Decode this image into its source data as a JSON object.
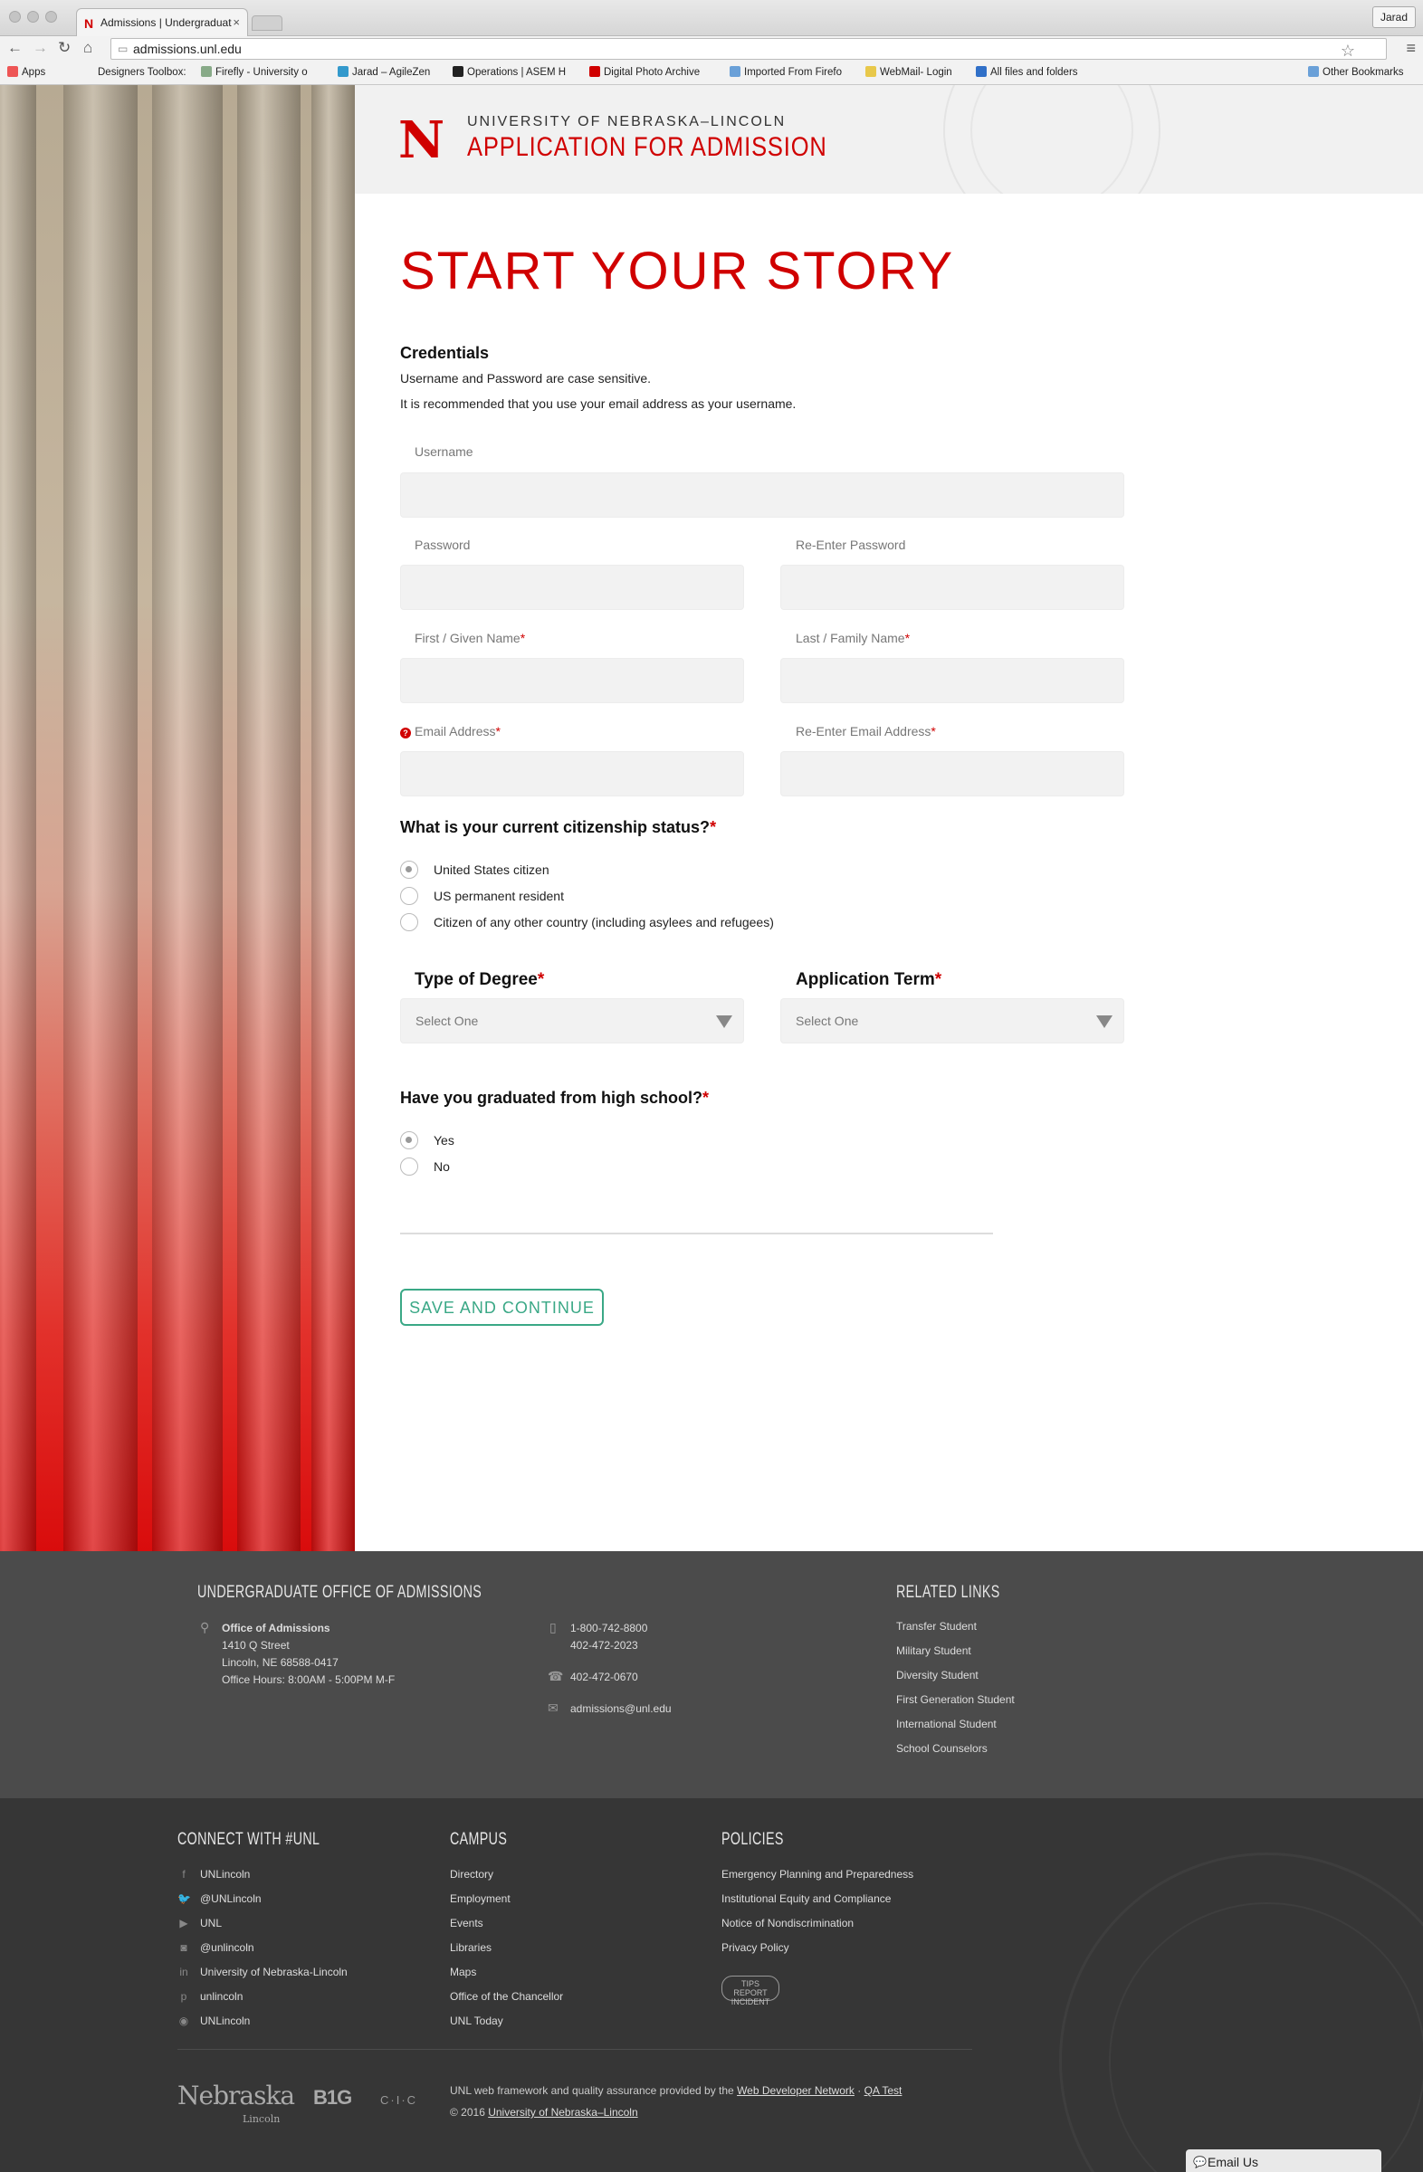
{
  "browser": {
    "tab_title": "Admissions | Undergraduat",
    "tab_favicon": "N",
    "tab_close": "×",
    "profile": "Jarad",
    "url": "admissions.unl.edu",
    "bookmarks": [
      {
        "label": "Apps",
        "color": "#e55"
      },
      {
        "label": "Designers Toolbox: G",
        "color": "#f2f2f2"
      },
      {
        "label": "Firefly - University o",
        "color": "#8a8"
      },
      {
        "label": "Jarad – AgileZen",
        "color": "#39c"
      },
      {
        "label": "Operations | ASEM H",
        "color": "#222"
      },
      {
        "label": "Digital Photo Archive",
        "color": "#d00000"
      },
      {
        "label": "Imported From Firefo",
        "color": "#6aa0d8"
      },
      {
        "label": "WebMail- Login",
        "color": "#e8c84a"
      },
      {
        "label": "All files and folders",
        "color": "#3070c8"
      },
      {
        "label": "Other Bookmarks",
        "color": "#6aa0d8"
      }
    ]
  },
  "header": {
    "logo": "N",
    "university": "UNIVERSITY OF NEBRASKA–LINCOLN",
    "title": "APPLICATION FOR ADMISSION"
  },
  "form": {
    "page_title": "START YOUR STORY",
    "credentials_title": "Credentials",
    "help_1": "Username and Password are case sensitive.",
    "help_2": "It is recommended that you use your email address as your username.",
    "username_label": "Username",
    "password_label": "Password",
    "reenter_password_label": "Re-Enter Password",
    "first_name_label": "First / Given Name",
    "last_name_label": "Last / Family Name",
    "email_label": "Email Address",
    "reenter_email_label": "Re-Enter Email Address",
    "required_mark": "*",
    "help_icon": "?",
    "citizenship_question": "What is your current citizenship status?",
    "citizenship_options": [
      "United States citizen",
      "US permanent resident",
      "Citizen of any other country (including asylees and refugees)"
    ],
    "degree_title": "Type of Degree",
    "degree_value": "Select One",
    "term_title": "Application Term",
    "term_value": "Select One",
    "hs_question": "Have you graduated from high school?",
    "hs_options": [
      "Yes",
      "No"
    ],
    "save_button": "SAVE AND CONTINUE"
  },
  "footer": {
    "office_heading": "UNDERGRADUATE OFFICE OF ADMISSIONS",
    "office_name": "Office of Admissions",
    "address_1": "1410 Q Street",
    "address_2": "Lincoln, NE 68588-0417",
    "hours": "Office Hours: 8:00AM - 5:00PM M-F",
    "phone_1": "1-800-742-8800",
    "phone_2": "402-472-2023",
    "fax": "402-472-0670",
    "email": "admissions@unl.edu",
    "related_heading": "RELATED LINKS",
    "related_links": [
      "Transfer Student",
      "Military Student",
      "Diversity Student",
      "First Generation Student",
      "International Student",
      "School Counselors"
    ],
    "connect_heading": "CONNECT WITH #UNL",
    "social": [
      {
        "icon": "f",
        "label": "UNLincoln"
      },
      {
        "icon": "🐦",
        "label": "@UNLincoln"
      },
      {
        "icon": "▶",
        "label": "UNL"
      },
      {
        "icon": "◙",
        "label": "@unlincoln"
      },
      {
        "icon": "in",
        "label": "University of Nebraska-Lincoln"
      },
      {
        "icon": "p",
        "label": "unlincoln"
      },
      {
        "icon": "◉",
        "label": "UNLincoln"
      }
    ],
    "campus_heading": "CAMPUS",
    "campus_links": [
      "Directory",
      "Employment",
      "Events",
      "Libraries",
      "Maps",
      "Office of the Chancellor",
      "UNL Today"
    ],
    "policies_heading": "POLICIES",
    "policy_links": [
      "Emergency Planning and Preparedness",
      "Institutional Equity and Compliance",
      "Notice of Nondiscrimination",
      "Privacy Policy"
    ],
    "tips_badge": "TIPS\nREPORT INCIDENT",
    "credit_prefix": "UNL web framework and quality assurance provided by the ",
    "credit_link_1": "Web Developer Network",
    "credit_sep": " · ",
    "credit_link_2": "QA Test",
    "copyright_prefix": "© 2016 ",
    "copyright_link": "University of Nebraska–Lincoln",
    "logo_nebraska": "Nebraska",
    "logo_nebraska_sub": "Lincoln",
    "logo_big": "B1G",
    "logo_cic": "C·I·C",
    "email_us": "Email Us"
  }
}
